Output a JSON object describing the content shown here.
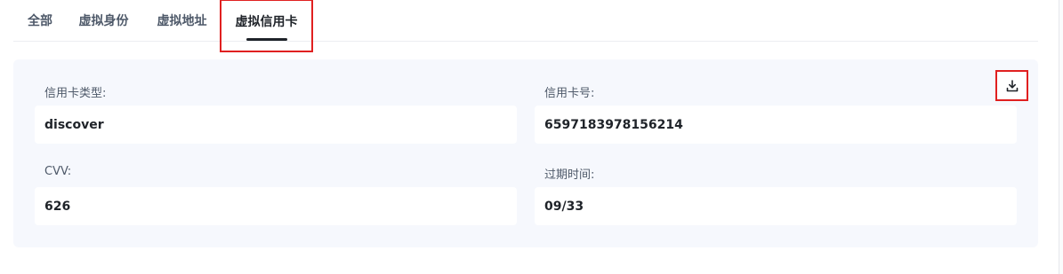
{
  "tabs": [
    {
      "label": "全部"
    },
    {
      "label": "虚拟身份"
    },
    {
      "label": "虚拟地址"
    },
    {
      "label": "虚拟信用卡"
    }
  ],
  "active_tab": "虚拟信用卡",
  "card": {
    "card_type": {
      "label": "信用卡类型:",
      "value": "discover"
    },
    "card_number": {
      "label": "信用卡号:",
      "value": "6597183978156214"
    },
    "cvv": {
      "label": "CVV:",
      "value": "626"
    },
    "expiry": {
      "label": "过期时间:",
      "value": "09/33"
    }
  },
  "icons": {
    "download": "download-icon"
  },
  "colors": {
    "highlight_border": "#e02020",
    "card_background": "#f6f8fd",
    "active_underline": "#1f2329"
  }
}
